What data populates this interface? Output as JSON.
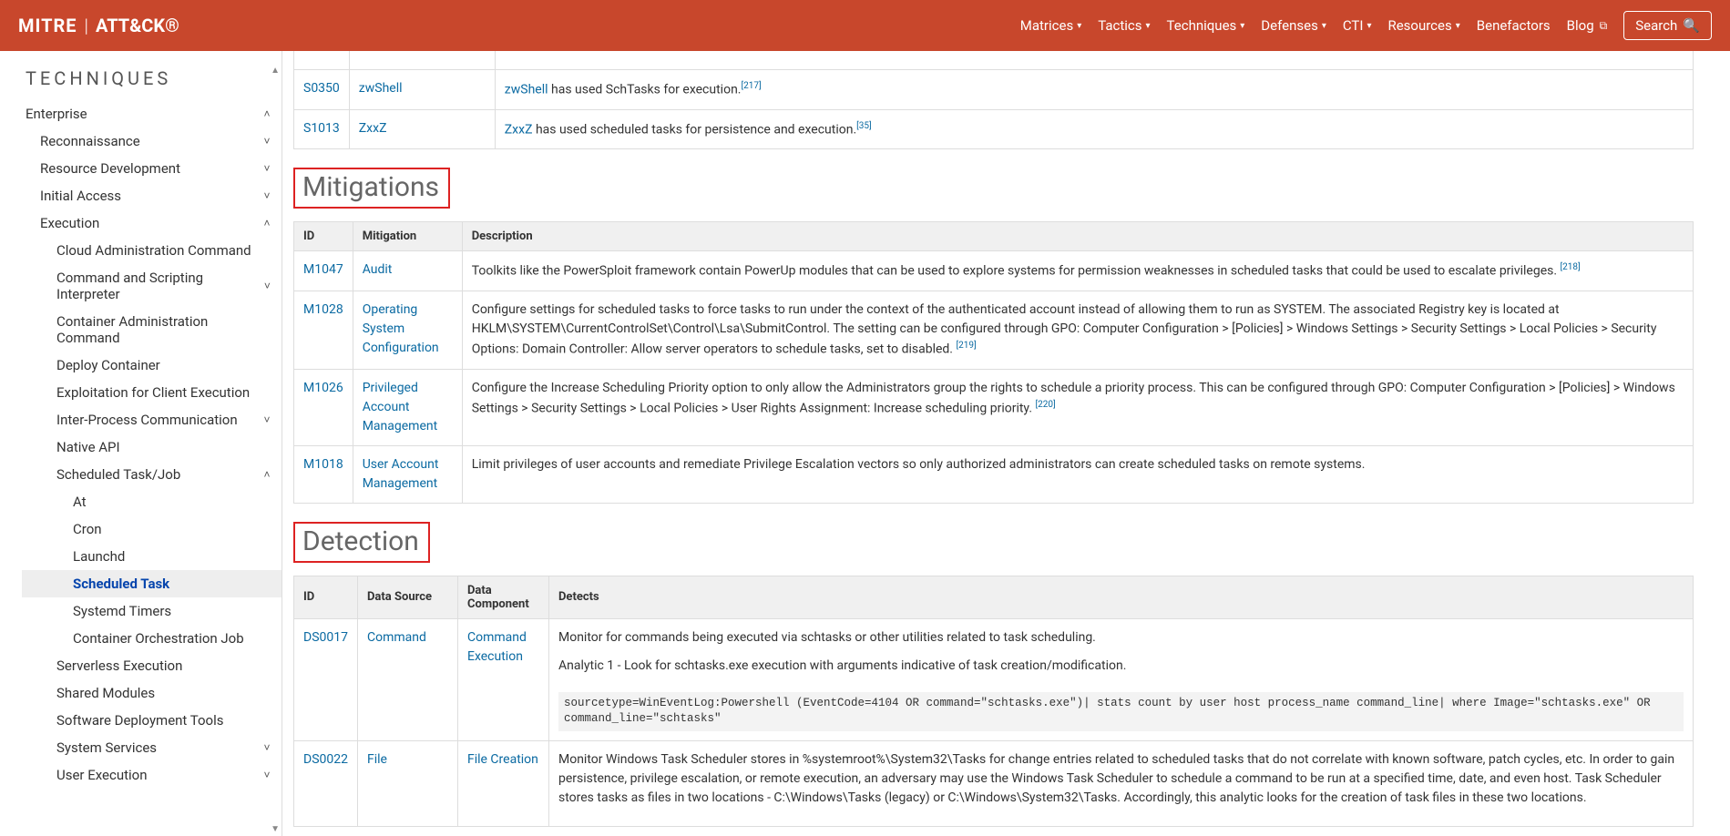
{
  "header": {
    "logo": {
      "mitre": "MITRE",
      "sep": "|",
      "attack": "ATT&CK®"
    },
    "nav": [
      "Matrices",
      "Tactics",
      "Techniques",
      "Defenses",
      "CTI",
      "Resources"
    ],
    "nav_plain": [
      "Benefactors"
    ],
    "blog": "Blog",
    "search": "Search"
  },
  "sidebar": {
    "title": "TECHNIQUES",
    "tree": [
      {
        "label": "Enterprise",
        "level": 1,
        "chev": "up"
      },
      {
        "label": "Reconnaissance",
        "level": 2,
        "chev": "down"
      },
      {
        "label": "Resource Development",
        "level": 2,
        "chev": "down"
      },
      {
        "label": "Initial Access",
        "level": 2,
        "chev": "down"
      },
      {
        "label": "Execution",
        "level": 2,
        "chev": "up"
      },
      {
        "label": "Cloud Administration Command",
        "level": 3,
        "chev": ""
      },
      {
        "label": "Command and Scripting Interpreter",
        "level": 3,
        "chev": "down"
      },
      {
        "label": "Container Administration Command",
        "level": 3,
        "chev": ""
      },
      {
        "label": "Deploy Container",
        "level": 3,
        "chev": ""
      },
      {
        "label": "Exploitation for Client Execution",
        "level": 3,
        "chev": ""
      },
      {
        "label": "Inter-Process Communication",
        "level": 3,
        "chev": "down"
      },
      {
        "label": "Native API",
        "level": 3,
        "chev": ""
      },
      {
        "label": "Scheduled Task/Job",
        "level": 3,
        "chev": "up"
      },
      {
        "label": "At",
        "level": 4,
        "chev": ""
      },
      {
        "label": "Cron",
        "level": 4,
        "chev": ""
      },
      {
        "label": "Launchd",
        "level": 4,
        "chev": ""
      },
      {
        "label": "Scheduled Task",
        "level": 4,
        "chev": "",
        "active": true
      },
      {
        "label": "Systemd Timers",
        "level": 4,
        "chev": ""
      },
      {
        "label": "Container Orchestration Job",
        "level": 4,
        "chev": ""
      },
      {
        "label": "Serverless Execution",
        "level": 3,
        "chev": ""
      },
      {
        "label": "Shared Modules",
        "level": 3,
        "chev": ""
      },
      {
        "label": "Software Deployment Tools",
        "level": 3,
        "chev": ""
      },
      {
        "label": "System Services",
        "level": 3,
        "chev": "down"
      },
      {
        "label": "User Execution",
        "level": 3,
        "chev": "down"
      }
    ]
  },
  "top_rows": [
    {
      "id": "S0350",
      "name": "zwShell",
      "desc_link": "zwShell",
      "desc_text": " has used SchTasks for execution.",
      "ref": "[217]"
    },
    {
      "id": "S1013",
      "name": "ZxxZ",
      "desc_link": "ZxxZ",
      "desc_text": " has used scheduled tasks for persistence and execution.",
      "ref": "[35]"
    }
  ],
  "mitigations": {
    "heading": "Mitigations",
    "headers": [
      "ID",
      "Mitigation",
      "Description"
    ],
    "rows": [
      {
        "id": "M1047",
        "name": "Audit",
        "desc": "Toolkits like the PowerSploit framework contain PowerUp modules that can be used to explore systems for permission weaknesses in scheduled tasks that could be used to escalate privileges. ",
        "ref": "[218]"
      },
      {
        "id": "M1028",
        "name": "Operating System Configuration",
        "desc": "Configure settings for scheduled tasks to force tasks to run under the context of the authenticated account instead of allowing them to run as SYSTEM. The associated Registry key is located at HKLM\\SYSTEM\\CurrentControlSet\\Control\\Lsa\\SubmitControl. The setting can be configured through GPO: Computer Configuration > [Policies] > Windows Settings > Security Settings > Local Policies > Security Options: Domain Controller: Allow server operators to schedule tasks, set to disabled. ",
        "ref": "[219]"
      },
      {
        "id": "M1026",
        "name": "Privileged Account Management",
        "desc": "Configure the Increase Scheduling Priority option to only allow the Administrators group the rights to schedule a priority process. This can be configured through GPO: Computer Configuration > [Policies] > Windows Settings > Security Settings > Local Policies > User Rights Assignment: Increase scheduling priority. ",
        "ref": "[220]"
      },
      {
        "id": "M1018",
        "name": "User Account Management",
        "desc": "Limit privileges of user accounts and remediate Privilege Escalation vectors so only authorized administrators can create scheduled tasks on remote systems.",
        "ref": ""
      }
    ]
  },
  "detection": {
    "heading": "Detection",
    "headers": [
      "ID",
      "Data Source",
      "Data Component",
      "Detects"
    ],
    "rows": [
      {
        "id": "DS0017",
        "source": "Command",
        "component": "Command Execution",
        "p1": "Monitor for commands being executed via schtasks or other utilities related to task scheduling.",
        "p2": "Analytic 1 - Look for schtasks.exe execution with arguments indicative of task creation/modification.",
        "code": "sourcetype=WinEventLog:Powershell (EventCode=4104 OR command=\"schtasks.exe\")| stats count by user host process_name command_line| where Image=\"schtasks.exe\" OR command_line=\"schtasks\""
      },
      {
        "id": "DS0022",
        "source": "File",
        "component": "File Creation",
        "p1": "Monitor Windows Task Scheduler stores in %systemroot%\\System32\\Tasks for change entries related to scheduled tasks that do not correlate with known software, patch cycles, etc. In order to gain persistence, privilege escalation, or remote execution, an adversary may use the Windows Task Scheduler to schedule a command to be run at a specified time, date, and even host. Task Scheduler stores tasks as files in two locations - C:\\Windows\\Tasks (legacy) or C:\\Windows\\System32\\Tasks. Accordingly, this analytic looks for the creation of task files in these two locations."
      }
    ]
  }
}
